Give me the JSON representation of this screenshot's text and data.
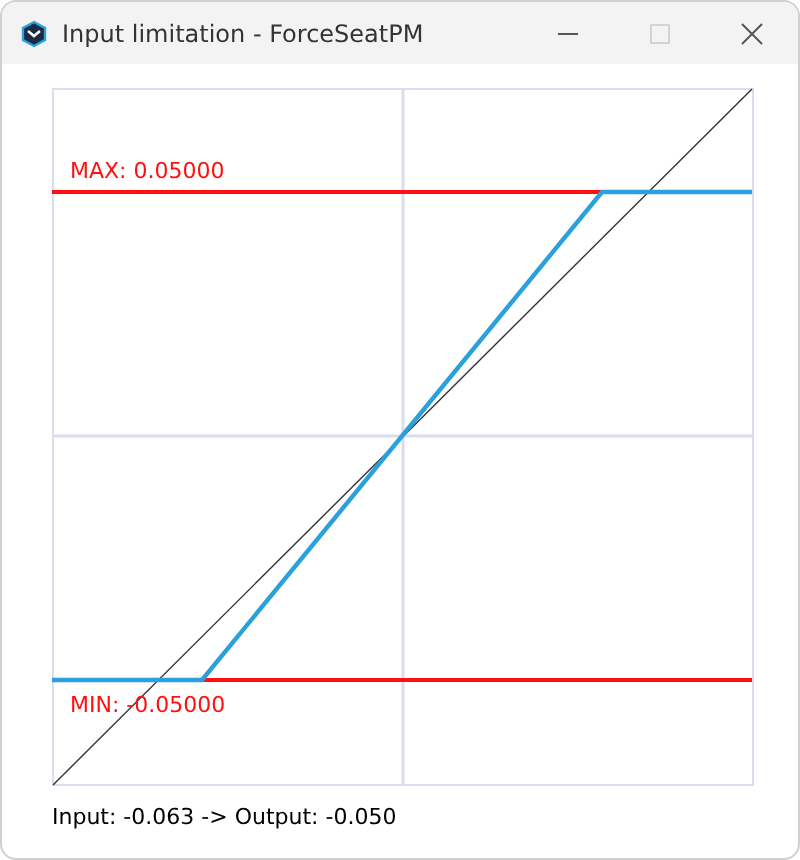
{
  "window": {
    "title": "Input limitation - ForceSeatPM",
    "controls": [
      {
        "kind": "minimize",
        "disabled": false
      },
      {
        "kind": "maximize",
        "disabled": true
      },
      {
        "kind": "close",
        "disabled": false
      }
    ]
  },
  "plot": {
    "max_label": "MAX: 0.05000",
    "min_label": "MIN: -0.05000"
  },
  "status": "Input: -0.063 -> Output: -0.050"
}
